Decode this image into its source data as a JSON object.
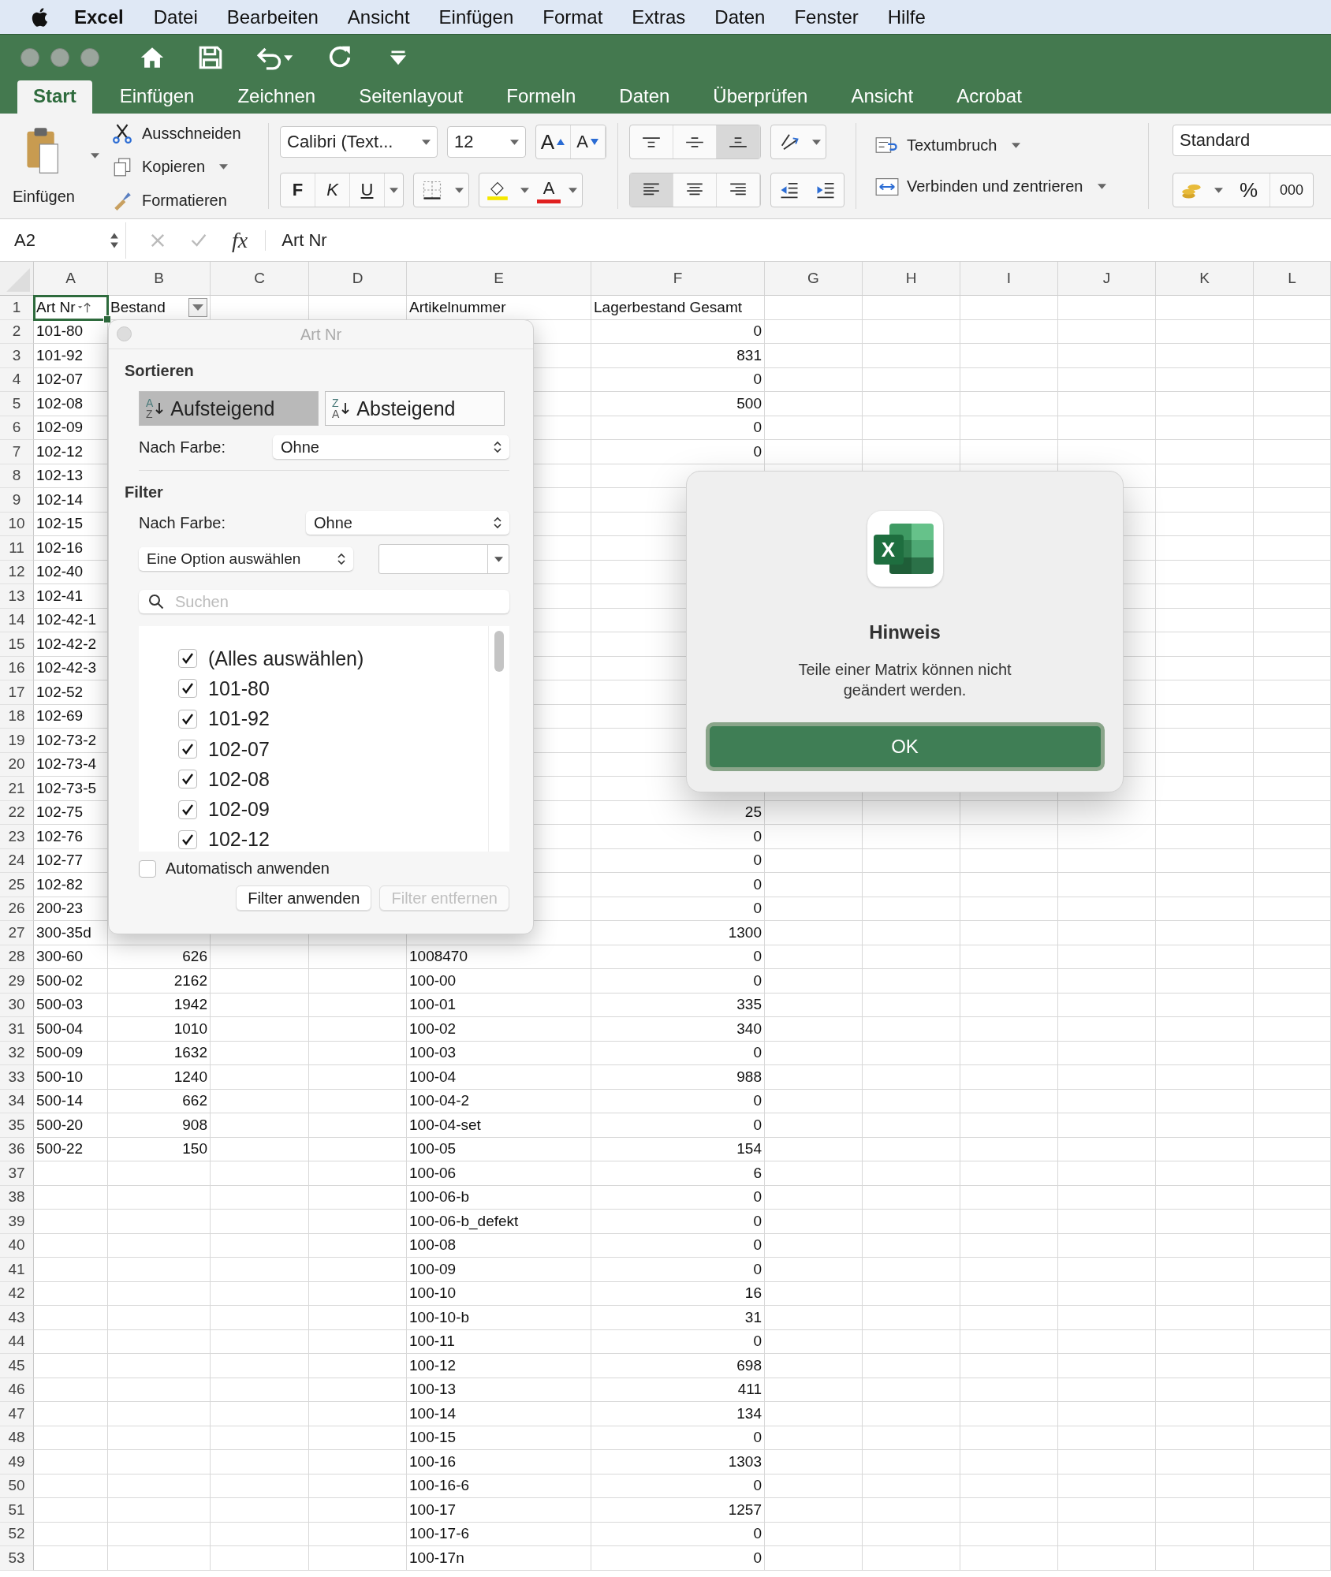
{
  "menu_bar": {
    "app": "Excel",
    "items": [
      "Datei",
      "Bearbeiten",
      "Ansicht",
      "Einfügen",
      "Format",
      "Extras",
      "Daten",
      "Fenster",
      "Hilfe"
    ]
  },
  "ribbon_tabs": [
    {
      "label": "Start",
      "selected": true
    },
    {
      "label": "Einfügen",
      "selected": false
    },
    {
      "label": "Zeichnen",
      "selected": false
    },
    {
      "label": "Seitenlayout",
      "selected": false
    },
    {
      "label": "Formeln",
      "selected": false
    },
    {
      "label": "Daten",
      "selected": false
    },
    {
      "label": "Überprüfen",
      "selected": false
    },
    {
      "label": "Ansicht",
      "selected": false
    },
    {
      "label": "Acrobat",
      "selected": false
    }
  ],
  "ribbon": {
    "paste": "Einfügen",
    "cut": "Ausschneiden",
    "copy": "Kopieren",
    "format_painter": "Formatieren",
    "font_name": "Calibri (Text...",
    "font_size": "12",
    "grow_font": "A",
    "shrink_font": "A",
    "bold": "F",
    "italic": "K",
    "underline": "U",
    "font_color": "A",
    "vertical_align": [
      {
        "kind": "top",
        "selected": false
      },
      {
        "kind": "middle",
        "selected": false
      },
      {
        "kind": "bottom",
        "selected": true
      }
    ],
    "horizontal_align": [
      {
        "kind": "left",
        "selected": true
      },
      {
        "kind": "center",
        "selected": false
      },
      {
        "kind": "right",
        "selected": false
      }
    ],
    "wrap_text": "Textumbruch",
    "merge": "Verbinden und zentrieren",
    "number_format": "Standard",
    "percent": "%",
    "thousands": "000"
  },
  "formula_bar": {
    "name_box": "A2",
    "fx": "fx",
    "content": "Art Nr"
  },
  "sheet": {
    "columns": [
      {
        "label": "A",
        "numeric": false
      },
      {
        "label": "B",
        "numeric": true
      },
      {
        "label": "C"
      },
      {
        "label": "D"
      },
      {
        "label": "E",
        "numeric": false
      },
      {
        "label": "F",
        "numeric": true
      },
      {
        "label": "G"
      },
      {
        "label": "H"
      },
      {
        "label": "I"
      },
      {
        "label": "J"
      },
      {
        "label": "K"
      },
      {
        "label": "L"
      }
    ],
    "header_row": {
      "n": "1",
      "cells": [
        {
          "text": "Art Nr",
          "selected": true,
          "kind": "sorted"
        },
        {
          "text": "Bestand",
          "selected": false,
          "kind": "filter_button"
        },
        null,
        null,
        {
          "text": "Artikelnummer",
          "selected": false
        },
        {
          "text": "Lagerbestand Gesamt",
          "selected": false
        }
      ]
    },
    "rows": [
      {
        "n": "2",
        "cells": [
          "101-80",
          null,
          null,
          null,
          null,
          "0"
        ]
      },
      {
        "n": "3",
        "cells": [
          "101-92",
          null,
          null,
          null,
          null,
          "831"
        ]
      },
      {
        "n": "4",
        "cells": [
          "102-07",
          null,
          null,
          null,
          null,
          "0"
        ]
      },
      {
        "n": "5",
        "cells": [
          "102-08",
          null,
          null,
          null,
          null,
          "500"
        ]
      },
      {
        "n": "6",
        "cells": [
          "102-09",
          null,
          null,
          null,
          null,
          "0"
        ]
      },
      {
        "n": "7",
        "cells": [
          "102-12",
          null,
          null,
          null,
          null,
          "0"
        ]
      },
      {
        "n": "8",
        "cells": [
          "102-13",
          null,
          null,
          null,
          null,
          null
        ]
      },
      {
        "n": "9",
        "cells": [
          "102-14",
          null,
          null,
          null,
          null,
          null
        ]
      },
      {
        "n": "10",
        "cells": [
          "102-15",
          null,
          null,
          null,
          null,
          null
        ]
      },
      {
        "n": "11",
        "cells": [
          "102-16",
          null,
          null,
          null,
          null,
          null
        ]
      },
      {
        "n": "12",
        "cells": [
          "102-40",
          null,
          null,
          null,
          null,
          null
        ]
      },
      {
        "n": "13",
        "cells": [
          "102-41",
          null,
          null,
          null,
          null,
          null
        ]
      },
      {
        "n": "14",
        "cells": [
          "102-42-1",
          null,
          null,
          null,
          null,
          null
        ]
      },
      {
        "n": "15",
        "cells": [
          "102-42-2",
          null,
          null,
          null,
          null,
          null
        ]
      },
      {
        "n": "16",
        "cells": [
          "102-42-3",
          null,
          null,
          null,
          null,
          null
        ]
      },
      {
        "n": "17",
        "cells": [
          "102-52",
          null,
          null,
          null,
          null,
          null
        ]
      },
      {
        "n": "18",
        "cells": [
          "102-69",
          null,
          null,
          null,
          null,
          null
        ]
      },
      {
        "n": "19",
        "cells": [
          "102-73-2",
          null,
          null,
          null,
          null,
          null
        ]
      },
      {
        "n": "20",
        "cells": [
          "102-73-4",
          null,
          null,
          null,
          null,
          null
        ]
      },
      {
        "n": "21",
        "cells": [
          "102-73-5",
          null,
          null,
          null,
          null,
          null
        ]
      },
      {
        "n": "22",
        "cells": [
          "102-75",
          null,
          null,
          null,
          null,
          "25"
        ]
      },
      {
        "n": "23",
        "cells": [
          "102-76",
          null,
          null,
          null,
          null,
          "0"
        ]
      },
      {
        "n": "24",
        "cells": [
          "102-77",
          null,
          null,
          null,
          null,
          "0"
        ]
      },
      {
        "n": "25",
        "cells": [
          "102-82",
          null,
          null,
          null,
          null,
          "0"
        ]
      },
      {
        "n": "26",
        "cells": [
          "200-23",
          null,
          null,
          null,
          null,
          "0"
        ]
      },
      {
        "n": "27",
        "cells": [
          "300-35d",
          null,
          null,
          null,
          null,
          "1300"
        ]
      },
      {
        "n": "28",
        "cells": [
          "300-60",
          "626",
          null,
          null,
          "1008470",
          "0"
        ]
      },
      {
        "n": "29",
        "cells": [
          "500-02",
          "2162",
          null,
          null,
          "100-00",
          "0"
        ]
      },
      {
        "n": "30",
        "cells": [
          "500-03",
          "1942",
          null,
          null,
          "100-01",
          "335"
        ]
      },
      {
        "n": "31",
        "cells": [
          "500-04",
          "1010",
          null,
          null,
          "100-02",
          "340"
        ]
      },
      {
        "n": "32",
        "cells": [
          "500-09",
          "1632",
          null,
          null,
          "100-03",
          "0"
        ]
      },
      {
        "n": "33",
        "cells": [
          "500-10",
          "1240",
          null,
          null,
          "100-04",
          "988"
        ]
      },
      {
        "n": "34",
        "cells": [
          "500-14",
          "662",
          null,
          null,
          "100-04-2",
          "0"
        ]
      },
      {
        "n": "35",
        "cells": [
          "500-20",
          "908",
          null,
          null,
          "100-04-set",
          "0"
        ]
      },
      {
        "n": "36",
        "cells": [
          "500-22",
          "150",
          null,
          null,
          "100-05",
          "154"
        ]
      },
      {
        "n": "37",
        "cells": [
          null,
          null,
          null,
          null,
          "100-06",
          "6"
        ]
      },
      {
        "n": "38",
        "cells": [
          null,
          null,
          null,
          null,
          "100-06-b",
          "0"
        ]
      },
      {
        "n": "39",
        "cells": [
          null,
          null,
          null,
          null,
          "100-06-b_defekt",
          "0"
        ]
      },
      {
        "n": "40",
        "cells": [
          null,
          null,
          null,
          null,
          "100-08",
          "0"
        ]
      },
      {
        "n": "41",
        "cells": [
          null,
          null,
          null,
          null,
          "100-09",
          "0"
        ]
      },
      {
        "n": "42",
        "cells": [
          null,
          null,
          null,
          null,
          "100-10",
          "16"
        ]
      },
      {
        "n": "43",
        "cells": [
          null,
          null,
          null,
          null,
          "100-10-b",
          "31"
        ]
      },
      {
        "n": "44",
        "cells": [
          null,
          null,
          null,
          null,
          "100-11",
          "0"
        ]
      },
      {
        "n": "45",
        "cells": [
          null,
          null,
          null,
          null,
          "100-12",
          "698"
        ]
      },
      {
        "n": "46",
        "cells": [
          null,
          null,
          null,
          null,
          "100-13",
          "411"
        ]
      },
      {
        "n": "47",
        "cells": [
          null,
          null,
          null,
          null,
          "100-14",
          "134"
        ]
      },
      {
        "n": "48",
        "cells": [
          null,
          null,
          null,
          null,
          "100-15",
          "0"
        ]
      },
      {
        "n": "49",
        "cells": [
          null,
          null,
          null,
          null,
          "100-16",
          "1303"
        ]
      },
      {
        "n": "50",
        "cells": [
          null,
          null,
          null,
          null,
          "100-16-6",
          "0"
        ]
      },
      {
        "n": "51",
        "cells": [
          null,
          null,
          null,
          null,
          "100-17",
          "1257"
        ]
      },
      {
        "n": "52",
        "cells": [
          null,
          null,
          null,
          null,
          "100-17-6",
          "0"
        ]
      },
      {
        "n": "53",
        "cells": [
          null,
          null,
          null,
          null,
          "100-17n",
          "0"
        ]
      }
    ]
  },
  "filter_popup": {
    "title": "Art Nr",
    "sort_heading": "Sortieren",
    "sort_buttons": [
      {
        "label": "Aufsteigend",
        "letters": [
          "A",
          "Z"
        ],
        "selected": true
      },
      {
        "label": "Absteigend",
        "letters": [
          "Z",
          "A"
        ],
        "selected": false
      }
    ],
    "sort_color_label": "Nach Farbe:",
    "sort_color_value": "Ohne",
    "filter_heading": "Filter",
    "filter_color_label": "Nach Farbe:",
    "filter_color_value": "Ohne",
    "option_select": "Eine Option auswählen",
    "search_placeholder": "Suchen",
    "items": [
      {
        "label": "(Alles auswählen)",
        "checked": true
      },
      {
        "label": "101-80",
        "checked": true
      },
      {
        "label": "101-92",
        "checked": true
      },
      {
        "label": "102-07",
        "checked": true
      },
      {
        "label": "102-08",
        "checked": true
      },
      {
        "label": "102-09",
        "checked": true
      },
      {
        "label": "102-12",
        "checked": true
      }
    ],
    "auto_apply": {
      "label": "Automatisch anwenden",
      "checked": false
    },
    "buttons": [
      {
        "label": "Filter anwenden",
        "disabled": false
      },
      {
        "label": "Filter entfernen",
        "disabled": true
      }
    ]
  },
  "dialog": {
    "icon_letter": "X",
    "title": "Hinweis",
    "message": "Teile einer Matrix können nicht geändert werden.",
    "button": "OK"
  }
}
